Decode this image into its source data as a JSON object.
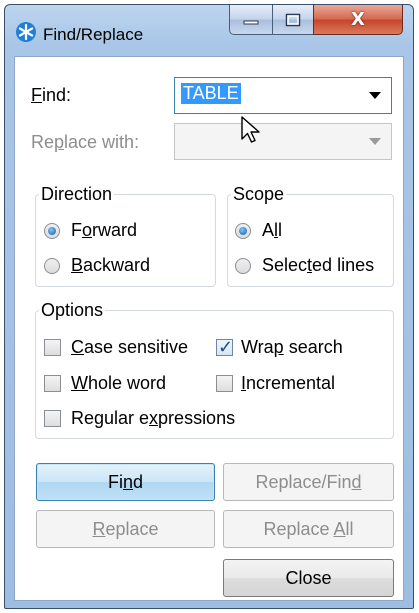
{
  "window": {
    "title": "Find/Replace",
    "controls": {
      "minimize": "minimize",
      "maximize": "maximize",
      "close": "X"
    }
  },
  "find": {
    "label_pre": "",
    "label_ul": "F",
    "label_post": "ind:",
    "value": "TABLE"
  },
  "replace": {
    "label_pre": "Re",
    "label_ul": "p",
    "label_post": "lace with:",
    "value": ""
  },
  "direction": {
    "title": "Direction",
    "forward": {
      "pre": "F",
      "ul": "o",
      "post": "rward",
      "selected": true
    },
    "backward": {
      "pre": "",
      "ul": "B",
      "post": "ackward",
      "selected": false
    }
  },
  "scope": {
    "title": "Scope",
    "all": {
      "pre": "A",
      "ul": "l",
      "post": "l",
      "selected": true
    },
    "selected_lines": {
      "pre": "Selec",
      "ul": "t",
      "post": "ed lines",
      "selected": false
    }
  },
  "options": {
    "title": "Options",
    "case_sensitive": {
      "pre": "",
      "ul": "C",
      "post": "ase sensitive",
      "checked": false
    },
    "wrap_search": {
      "pre": "Wra",
      "ul": "p",
      "post": " search",
      "checked": true
    },
    "whole_word": {
      "pre": "",
      "ul": "W",
      "post": "hole word",
      "checked": false
    },
    "incremental": {
      "pre": "",
      "ul": "I",
      "post": "ncremental",
      "checked": false
    },
    "regular_expressions": {
      "pre": "Regular e",
      "ul": "x",
      "post": "pressions",
      "checked": false
    }
  },
  "buttons": {
    "find": {
      "pre": "Fi",
      "ul": "n",
      "post": "d"
    },
    "replace_find": {
      "pre": "Replace/Fin",
      "ul": "d",
      "post": ""
    },
    "replace": {
      "pre": "",
      "ul": "R",
      "post": "eplace"
    },
    "replace_all": {
      "pre": "Replace ",
      "ul": "A",
      "post": "ll"
    },
    "close": {
      "label": "Close"
    }
  },
  "colors": {
    "accent": "#3399ff",
    "title_bar": "#a9c6e8",
    "close_button": "#c7452a"
  }
}
